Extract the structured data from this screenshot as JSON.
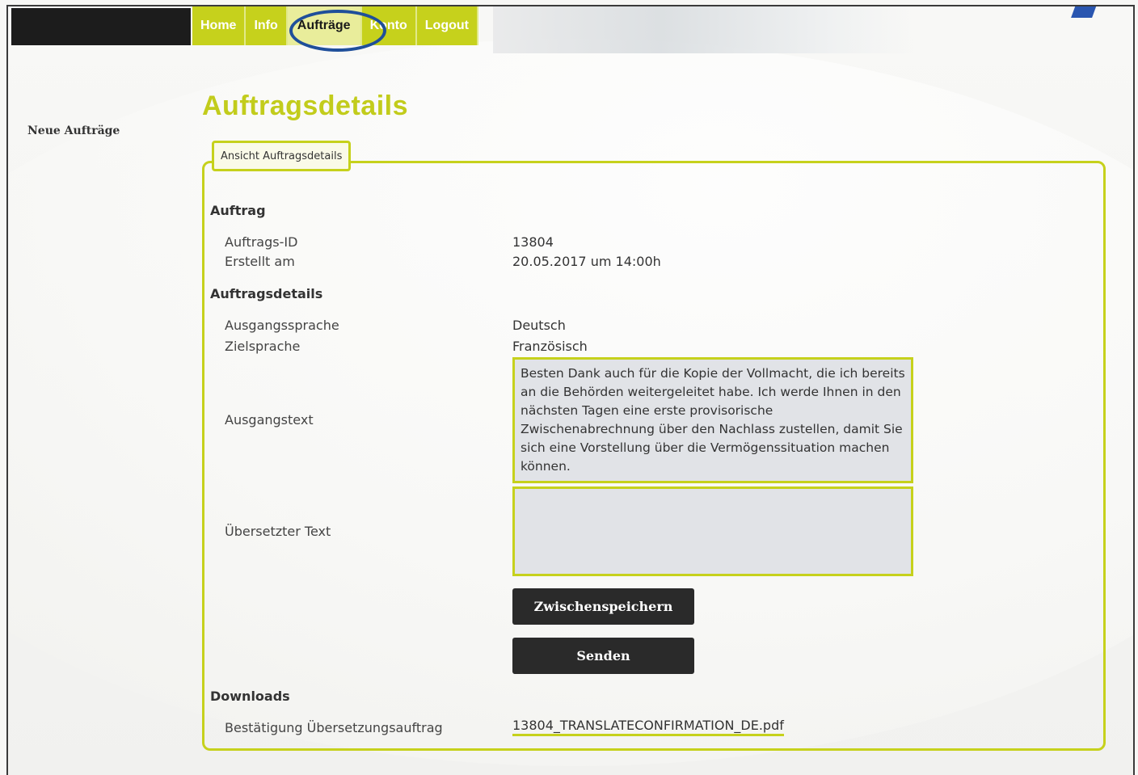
{
  "nav": {
    "items": [
      {
        "label": "Home"
      },
      {
        "label": "Info"
      },
      {
        "label": "Aufträge"
      },
      {
        "label": "Konto"
      },
      {
        "label": "Logout"
      }
    ]
  },
  "sidebar": {
    "new_orders": "Neue Aufträge"
  },
  "page": {
    "title": "Auftragsdetails",
    "tab": "Ansicht Auftragsdetails"
  },
  "order": {
    "heading": "Auftrag",
    "id_label": "Auftrags-ID",
    "id_value": "13804",
    "created_label": "Erstellt am",
    "created_value": "20.05.2017 um 14:00h"
  },
  "details": {
    "heading": "Auftragsdetails",
    "source_lang_label": "Ausgangssprache",
    "source_lang_value": "Deutsch",
    "target_lang_label": "Zielsprache",
    "target_lang_value": "Französisch",
    "source_text_label": "Ausgangstext",
    "source_text_value": "Besten Dank auch für die Kopie der Vollmacht, die ich bereits an die Behörden weitergeleitet habe. Ich werde Ihnen in den nächsten Tagen eine erste provisorische Zwischenabrechnung über den Nachlass zustellen, damit Sie sich eine Vorstellung über die Vermögenssituation machen können.",
    "translated_text_label": "Übersetzter Text",
    "translated_text_value": ""
  },
  "actions": {
    "save_label": "Zwischenspeichern",
    "send_label": "Senden"
  },
  "downloads": {
    "heading": "Downloads",
    "confirmation_label": "Bestätigung Übersetzungsauftrag",
    "confirmation_file": "13804_TRANSLATECONFIRMATION_DE.pdf"
  },
  "colors": {
    "accent": "#c6d11c",
    "dark": "#2a2a2a",
    "highlight": "#1f4f9a"
  }
}
